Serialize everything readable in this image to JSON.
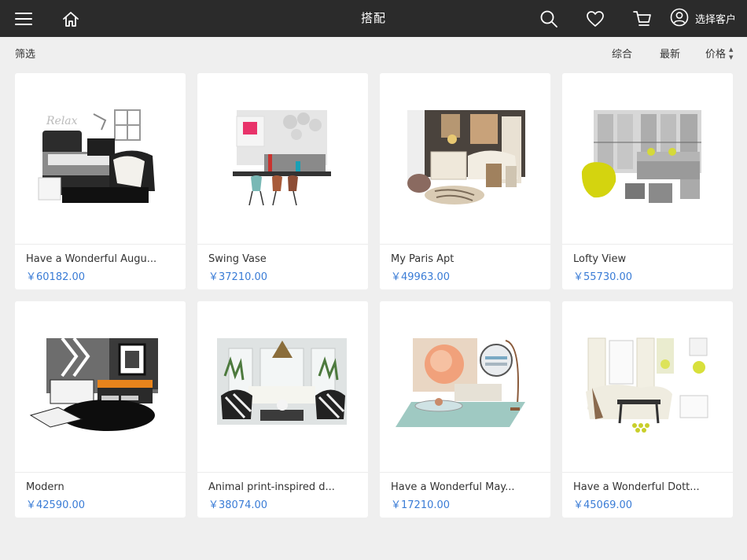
{
  "header": {
    "title": "搭配",
    "customer_label": "选择客户"
  },
  "filterbar": {
    "filter_label": "筛选",
    "sort": [
      "综合",
      "最新",
      "价格"
    ]
  },
  "icons": {
    "menu": "hamburger-menu-icon",
    "home": "home-icon",
    "search": "search-icon",
    "favorite": "heart-icon",
    "cart": "cart-icon",
    "customer": "user-circle-icon"
  },
  "colors": {
    "header_bg": "#2b2b2b",
    "page_bg": "#efefef",
    "price": "#3a7cd6"
  },
  "products": [
    {
      "name": "Have a Wonderful Augu...",
      "price": "￥60182.00"
    },
    {
      "name": "Swing Vase",
      "price": "￥37210.00"
    },
    {
      "name": "My Paris Apt",
      "price": "￥49963.00"
    },
    {
      "name": "Lofty View",
      "price": "￥55730.00"
    },
    {
      "name": "Modern",
      "price": "￥42590.00"
    },
    {
      "name": "Animal print-inspired d...",
      "price": "￥38074.00"
    },
    {
      "name": "Have a Wonderful May...",
      "price": "￥17210.00"
    },
    {
      "name": "Have a Wonderful Dott...",
      "price": "￥45069.00"
    }
  ]
}
